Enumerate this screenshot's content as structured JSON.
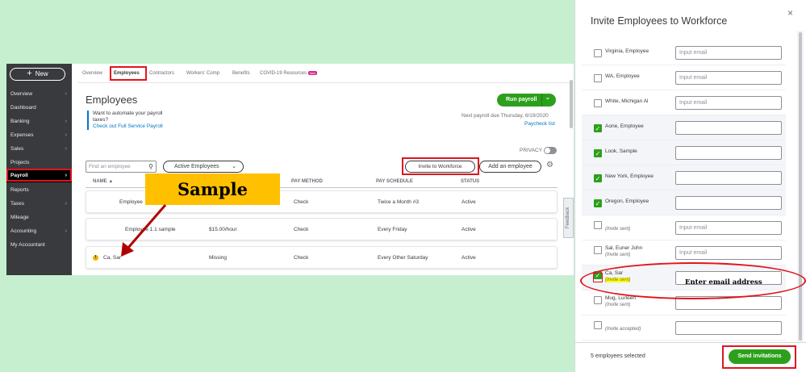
{
  "sidebar": {
    "new_label": "New",
    "items": [
      {
        "label": "Overview",
        "chev": "›"
      },
      {
        "label": "Dashboard",
        "chev": ""
      },
      {
        "label": "Banking",
        "chev": "›"
      },
      {
        "label": "Expenses",
        "chev": "›"
      },
      {
        "label": "Sales",
        "chev": "›"
      },
      {
        "label": "Projects",
        "chev": ""
      },
      {
        "label": "Payroll",
        "chev": "›"
      },
      {
        "label": "Reports",
        "chev": ""
      },
      {
        "label": "Taxes",
        "chev": "›"
      },
      {
        "label": "Mileage",
        "chev": ""
      },
      {
        "label": "Accounting",
        "chev": "›"
      },
      {
        "label": "My Accountant",
        "chev": ""
      }
    ],
    "active_item": "Payroll"
  },
  "tabs": {
    "overview": "Overview",
    "employees": "Employees",
    "contractors": "Contractors",
    "workers_comp": "Workers' Comp",
    "benefits": "Benefits",
    "covid": "COVID-19 Resources",
    "new_badge": "new"
  },
  "page": {
    "title": "Employees",
    "promo_line1": "Want to automate your payroll",
    "promo_line2": "taxes?",
    "promo_link": "Check out Full Service Payroll",
    "run_payroll": "Run payroll",
    "next_payroll": "Next payroll due Thursday, 6/19/2020",
    "paycheck_list": "Paycheck list",
    "privacy": "PRIVACY",
    "search_placeholder": "Find an employee",
    "filter": "Active Employees",
    "invite_btn": "Invite to Workforce",
    "add_employee": "Add an employee"
  },
  "table": {
    "headers": {
      "name": "NAME ▲",
      "pay_method": "PAY METHOD",
      "pay_schedule": "PAY SCHEDULE",
      "status": "STATUS"
    },
    "rows": [
      {
        "name": "Employee",
        "pay_rate": "",
        "pay_method": "Check",
        "pay_schedule": "Twice a Month #3",
        "status": "Active"
      },
      {
        "name": "Employee 1.1 sample",
        "pay_rate": "$15.00/hour",
        "pay_method": "Check",
        "pay_schedule": "Every Friday",
        "status": "Active"
      },
      {
        "name": "Ca, Sar",
        "pay_rate": "Missing",
        "pay_method": "Check",
        "pay_schedule": "Every Other Saturday",
        "status": "Active",
        "warn": "!"
      }
    ]
  },
  "feedback": "Feedback",
  "sample_callout": "Sample",
  "modal": {
    "title": "Invite Employees to Workforce",
    "close": "×",
    "employees": [
      {
        "name": "Virginia, Employee",
        "sub": "",
        "checked": false,
        "placeholder": "Input email"
      },
      {
        "name": "WA, Employee",
        "sub": "",
        "checked": false,
        "placeholder": "Input email"
      },
      {
        "name": "White, Michigan Al",
        "sub": "",
        "checked": false,
        "placeholder": "Input email"
      },
      {
        "name": "Aone, Employee",
        "sub": "",
        "checked": true,
        "placeholder": ""
      },
      {
        "name": "Look, Sample",
        "sub": "",
        "checked": true,
        "placeholder": ""
      },
      {
        "name": "New York, Employee",
        "sub": "",
        "checked": true,
        "placeholder": ""
      },
      {
        "name": "Oregon, Employee",
        "sub": "",
        "checked": true,
        "placeholder": ""
      },
      {
        "name": "",
        "sub": "(Invite sent)",
        "checked": false,
        "placeholder": "Input email"
      },
      {
        "name": "Sal, Euner John",
        "sub": "(Invite sent)",
        "checked": false,
        "placeholder": "Input email"
      },
      {
        "name": "Ca, Sar",
        "sub": "(Invite sent)",
        "checked": true,
        "placeholder": ""
      },
      {
        "name": "Mug, Lurleen",
        "sub": "(Invite sent)",
        "checked": false,
        "placeholder": ""
      },
      {
        "name": "",
        "sub": "(Invite accepted)",
        "checked": false,
        "placeholder": ""
      }
    ],
    "enter_email_note": "Enter email address",
    "selected_count": "5 employees selected",
    "send_btn": "Send invitations"
  },
  "colors": {
    "accent_green": "#2ca01c",
    "link_blue": "#0077c5",
    "annotation_red": "#e0141e",
    "callout_yellow": "#ffc000"
  }
}
